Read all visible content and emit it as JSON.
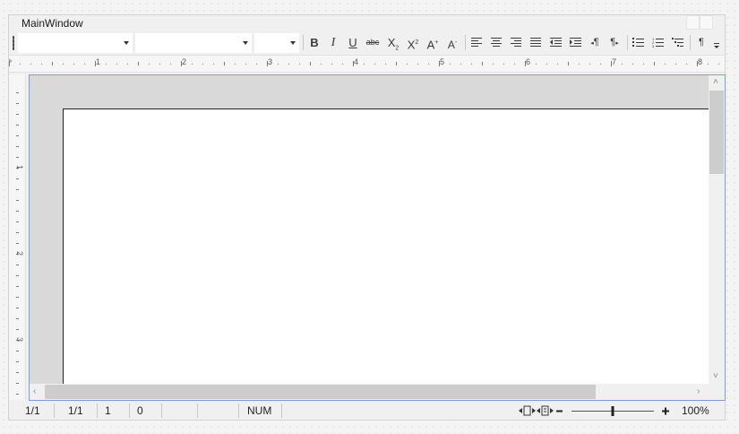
{
  "window": {
    "title": "MainWindow"
  },
  "toolbar": {
    "font_name": {
      "value": ""
    },
    "font_family": {
      "value": ""
    },
    "font_size": {
      "value": ""
    },
    "buttons": {
      "bold": "B",
      "italic": "I",
      "underline": "U",
      "strike": "abc",
      "subscript": "X",
      "subscript_mark": "2",
      "superscript": "X",
      "superscript_mark": "2",
      "grow_font": "A",
      "shrink_font": "A",
      "pilcrow_ltr": "¶",
      "pilcrow_rtl": "¶",
      "show_marks": "¶"
    },
    "icons": [
      "align-left-icon",
      "align-center-icon",
      "align-right-icon",
      "align-justify-icon",
      "decrease-indent-icon",
      "increase-indent-icon",
      "bullet-list-icon",
      "numbered-list-icon",
      "multilevel-list-icon",
      "overflow-icon"
    ]
  },
  "ruler": {
    "horizontal_labels": [
      "1",
      "2",
      "3",
      "4",
      "5",
      "6",
      "7",
      "8"
    ],
    "vertical_labels": [
      "1",
      "2",
      "3"
    ]
  },
  "status": {
    "page": "1/1",
    "section": "1/1",
    "line": "1",
    "column": "0",
    "num_lock": "NUM",
    "zoom_label": "100%",
    "zoom_level": 1.0
  },
  "colors": {
    "accent_border": "#7a9fd8",
    "page_background": "#ffffff",
    "canvas_gray": "#d9d9d9"
  }
}
